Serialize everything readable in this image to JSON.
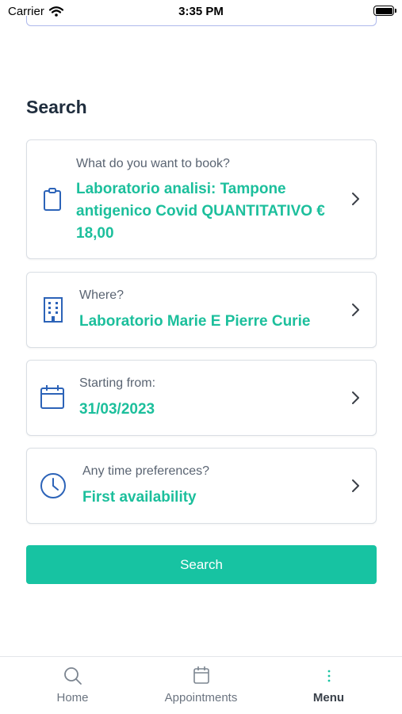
{
  "status_bar": {
    "carrier": "Carrier",
    "time": "3:35 PM"
  },
  "search": {
    "title": "Search",
    "button_label": "Search"
  },
  "cards": [
    {
      "label": "What do you want to book?",
      "value": "Laboratorio analisi: Tampone antigenico Covid QUANTITATIVO € 18,00",
      "icon": "clipboard-icon"
    },
    {
      "label": "Where?",
      "value": "Laboratorio Marie E Pierre Curie",
      "icon": "building-icon"
    },
    {
      "label": "Starting from:",
      "value": "31/03/2023",
      "icon": "calendar-icon"
    },
    {
      "label": "Any time preferences?",
      "value": "First availability",
      "icon": "clock-icon"
    }
  ],
  "tabs": [
    {
      "label": "Home",
      "icon": "search-icon"
    },
    {
      "label": "Appointments",
      "icon": "calendar-icon"
    },
    {
      "label": "Menu",
      "icon": "more-vertical-icon",
      "active": true
    }
  ],
  "colors": {
    "accent": "#17c3a2",
    "value_text": "#1cbf9c",
    "icon_blue": "#2c63b8"
  }
}
